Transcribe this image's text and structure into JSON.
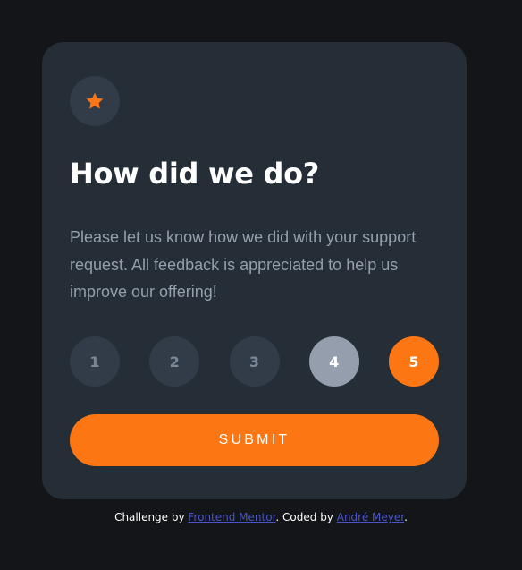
{
  "colors": {
    "page_background": "#131518",
    "card_background": "#252d37",
    "circle_background": "#323c48",
    "accent_orange": "#fc7614",
    "hover_grey": "#959eac",
    "muted_text": "#959eac",
    "link_blue": "#4b55c9"
  },
  "card": {
    "icon": "star-icon",
    "title": "How did we do?",
    "description": "Please let us know how we did with your support request. All feedback is appreciated to help us improve our offering!"
  },
  "ratings": [
    {
      "label": "1",
      "state": "default"
    },
    {
      "label": "2",
      "state": "default"
    },
    {
      "label": "3",
      "state": "default"
    },
    {
      "label": "4",
      "state": "hover"
    },
    {
      "label": "5",
      "state": "selected"
    }
  ],
  "submit": {
    "label": "SUBMIT"
  },
  "attribution": {
    "prefix": "Challenge by ",
    "challenge_link": "Frontend Mentor",
    "middle": ". Coded by ",
    "author_link": "André Meyer",
    "suffix": "."
  }
}
